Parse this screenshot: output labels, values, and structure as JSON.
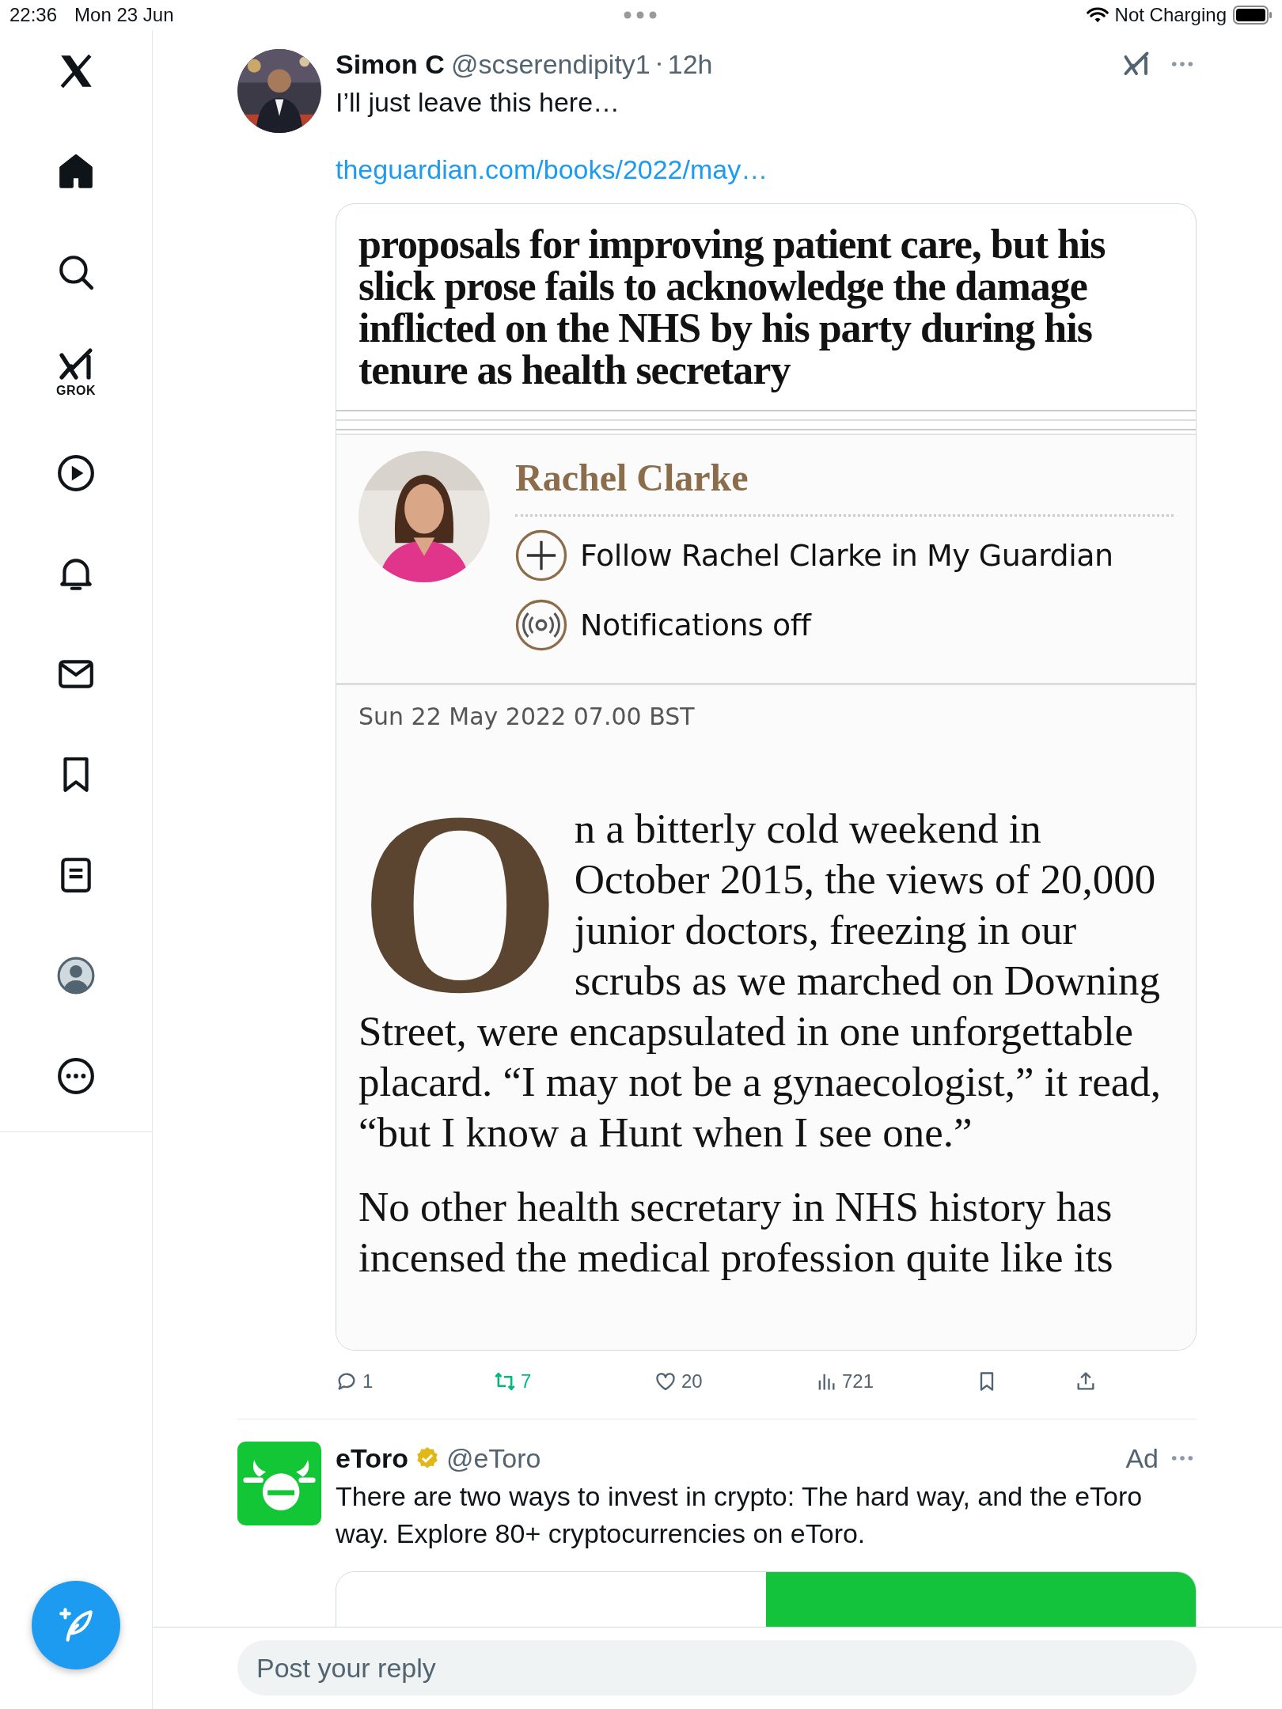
{
  "status_bar": {
    "time": "22:36",
    "date": "Mon 23 Jun",
    "battery_label": "Not Charging"
  },
  "sidebar": {
    "nav": [
      {
        "kind": "logo",
        "selected": false
      },
      {
        "kind": "home",
        "selected": true
      },
      {
        "kind": "search",
        "selected": false
      },
      {
        "kind": "grok",
        "label": "GROK",
        "selected": false
      },
      {
        "kind": "video",
        "selected": false
      },
      {
        "kind": "notifications",
        "selected": false
      },
      {
        "kind": "messages",
        "selected": false
      },
      {
        "kind": "bookmarks",
        "selected": false
      },
      {
        "kind": "lists",
        "selected": false
      },
      {
        "kind": "profile",
        "selected": false
      },
      {
        "kind": "more",
        "selected": false
      }
    ]
  },
  "tweet": {
    "author": "Simon C",
    "handle": "@scserendipity1",
    "time": "12h",
    "text": "I’ll just leave this here…",
    "link": "theguardian.com/books/2022/may…",
    "article": {
      "standfirst": "proposals for improving patient care, but his slick prose fails to acknowledge the damage inflicted on the NHS by his party during his tenure as health secretary",
      "author": "Rachel Clarke",
      "follow_label": "Follow Rachel Clarke in My Guardian",
      "notifications_label": "Notifications off",
      "date": "Sun 22 May 2022 07.00 BST",
      "drop_cap": "O",
      "paragraphs": [
        "n a bitterly cold weekend in October 2015, the views of 20,000 junior doctors, freezing in our scrubs as we marched on Downing Street, were encapsulated in one unforgettable placard. “I may not be a gynaecologist,” it read, “but I know a Hunt when I see one.”",
        "No other health secretary in NHS history has incensed the medical profession quite like its"
      ]
    },
    "actions": [
      {
        "kind": "reply",
        "count": "1",
        "active": false
      },
      {
        "kind": "repost",
        "count": "7",
        "active": true
      },
      {
        "kind": "like",
        "count": "20",
        "active": false
      },
      {
        "kind": "views",
        "count": "721",
        "active": false
      },
      {
        "kind": "bookmark",
        "active": false
      },
      {
        "kind": "share",
        "active": false
      }
    ]
  },
  "ad": {
    "name": "eToro",
    "verified": true,
    "handle": "@eToro",
    "label": "Ad",
    "text": "There are two ways to invest in crypto: The hard way, and the eToro way. Explore 80+ cryptocurrencies on eToro."
  },
  "reply_bar": {
    "placeholder": "Post your reply"
  }
}
